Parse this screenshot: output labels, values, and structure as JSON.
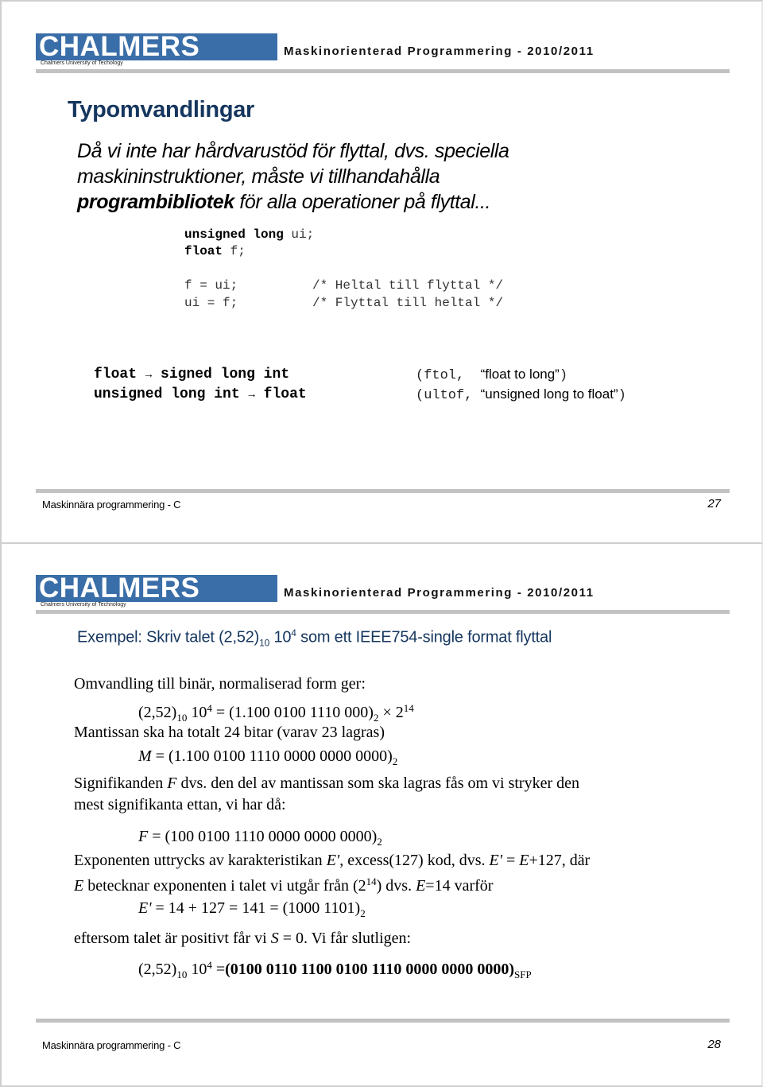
{
  "header": {
    "logo_text": "CHALMERS",
    "logo_subtitle": "Chalmers University of Techology",
    "logo_subtitle_2": "Chalmers University of Technology",
    "course_title": "Maskinorienterad Programmering - 2010/2011",
    "brand_color": "#3a6ea8",
    "heading_color": "#15365e"
  },
  "slide27": {
    "heading": "Typomvandlingar",
    "intro_line1": "Då vi inte har hårdvarustöd för flyttal, dvs. speciella",
    "intro_line2": "maskininstruktioner,  måste vi tillhandahålla",
    "intro_bold": "programbibliotek",
    "intro_line3_rest": " för alla operationer på flyttal...",
    "code": [
      {
        "kw": "unsigned long",
        "rest": " ui;"
      },
      {
        "kw": "float",
        "rest": " f;"
      },
      {
        "stmt": "f = ui;",
        "comment": "/* Heltal till flyttal */"
      },
      {
        "stmt": "ui = f;",
        "comment": "/* Flyttal till heltal */"
      }
    ],
    "conversions": [
      {
        "from": "float",
        "arrow": "→",
        "to": "signed long int",
        "fn": "(ftol,",
        "desc": "“float to long”",
        "close": ")"
      },
      {
        "from": "unsigned long int",
        "arrow": "→",
        "to": "float",
        "fn": "(ultof,",
        "desc": "“unsigned long to float”",
        "close": ")"
      }
    ],
    "footer_left": "Maskinnära programmering - C",
    "page_number": "27"
  },
  "slide28": {
    "title_pre": "Exempel: Skriv talet (2,52)",
    "title_sub": "10",
    "title_mid": " 10",
    "title_sup": "4",
    "title_post": " som ett IEEE754-single format flyttal",
    "line1": "Omvandling till binär, normaliserad form ger:",
    "eq1": {
      "a": "(2,52)",
      "a_sub": "10",
      "b": " 10",
      "b_sup": "4",
      "c": " =  (1.100 0100 1110 000)",
      "c_sub": "2",
      "d": " × 2",
      "d_sup": "14"
    },
    "line2": "Mantissan ska ha totalt 24 bitar  (varav 23 lagras)",
    "eq2": {
      "var": "M",
      "rest": " = (1.100 0100 1110 0000 0000 0000)",
      "sub": "2"
    },
    "line3_pre": "Signifikanden ",
    "line3_var": "F",
    "line3_post": "  dvs. den del av mantissan som ska lagras fås om vi stryker den",
    "line4": "mest signifikanta ettan, vi har då:",
    "eq3": {
      "var": "F",
      "rest": " = (100 0100 1110 0000 0000 0000)",
      "sub": "2"
    },
    "line5_a": "Exponenten uttrycks av karakteristikan ",
    "line5_var1": "E'",
    "line5_b": ", excess(127) kod,  dvs. ",
    "line5_var2": "E'",
    "line5_c": " = ",
    "line5_var3": "E",
    "line5_d": "+127, där",
    "line6_var": "E",
    "line6_a": " betecknar exponenten i talet vi utgår från (2",
    "line6_sup": "14",
    "line6_b": ") dvs. ",
    "line6_var2": "E",
    "line6_c": "=14 varför",
    "eq4": {
      "var": "E'",
      "rest": " = 14 + 127 = 141 = (1000 1101)",
      "sub": "2"
    },
    "line7_a": "eftersom talet är positivt får vi ",
    "line7_var": "S",
    "line7_b": " = 0. Vi får slutligen:",
    "eq5": {
      "a": "(2,52)",
      "a_sub": "10",
      "b": " 10",
      "b_sup": "4",
      "c": " =",
      "bits": "(0100 0110 1100 0100 1110 0000 0000 0000)",
      "sub": "SFP"
    },
    "footer_left": "Maskinnära programmering - C",
    "page_number": "28"
  }
}
